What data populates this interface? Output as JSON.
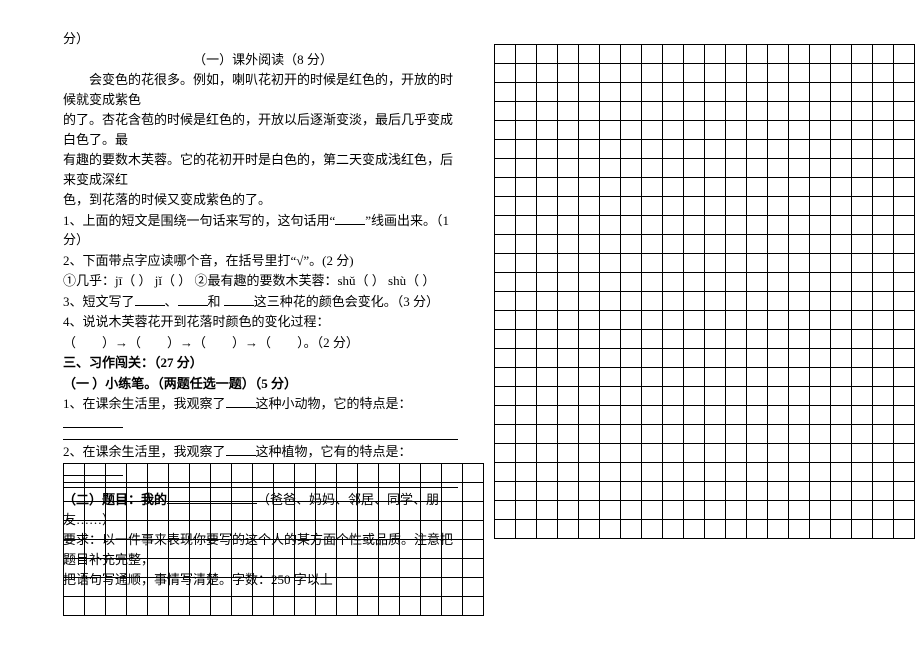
{
  "header": {
    "fen": "分）",
    "section1_title": "（一）课外阅读（8 分）"
  },
  "passage": {
    "l1": "会变色的花很多。例如，喇叭花初开的时候是红色的，开放的时候就变成紫色",
    "l2": "的了。杏花含苞的时候是红色的，开放以后逐渐变淡，最后几乎变成白色了。最",
    "l3": "有趣的要数木芙蓉。它的花初开时是白色的，第二天变成浅红色，后来变成深红",
    "l4": "色，到花落的时候又变成紫色的了。"
  },
  "q1": {
    "text_a": "1、上面的短文是围绕一句话来写的，这句话用“",
    "text_b": "”线画出来。（1 分）"
  },
  "q2": {
    "text": "2、下面带点字应读哪个音，在括号里打“√”。(2 分)",
    "opts": "①几乎：jī（  ）  jǐ（  ） ②最有趣的要数木芙蓉：shǔ（  ）  shù（  ）"
  },
  "q3": {
    "pre": "3、短文写了",
    "mid1": "、",
    "mid2": "和",
    "post": "这三种花的颜色会变化。（3 分）"
  },
  "q4": {
    "text": "4、说说木芙蓉花开到花落时颜色的变化过程：",
    "flow_a": "（",
    "flow_b": "）→（",
    "flow_c": "）→（",
    "flow_d": "）→（",
    "flow_end": "）。（2 分）"
  },
  "section3": {
    "title": "三、习作闯关：（27 分）",
    "sub1": "（一 ）小练笔。（两题任选一题）（5 分）",
    "q1a": "1、在课余生活里，我观察了",
    "q1b": "这种小动物，它的特点是：",
    "q2a": "2、在课余生活里，我观察了",
    "q2b": "这种植物，它有的特点是：",
    "sub2a": "（二）题目：我的",
    "sub2b": "（爸爸、妈妈、邻居、同学、朋友……）",
    "req1": "要求：以一件事来表现你要写的这个人的某方面个性或品质。注意把题目补充完整，",
    "req2": "把语句写通顺，事情写清楚。字数：250 字以上"
  },
  "grids": {
    "right": {
      "rows": 26,
      "cols": 20
    },
    "bottom": {
      "rows": 8,
      "cols": 20
    }
  }
}
